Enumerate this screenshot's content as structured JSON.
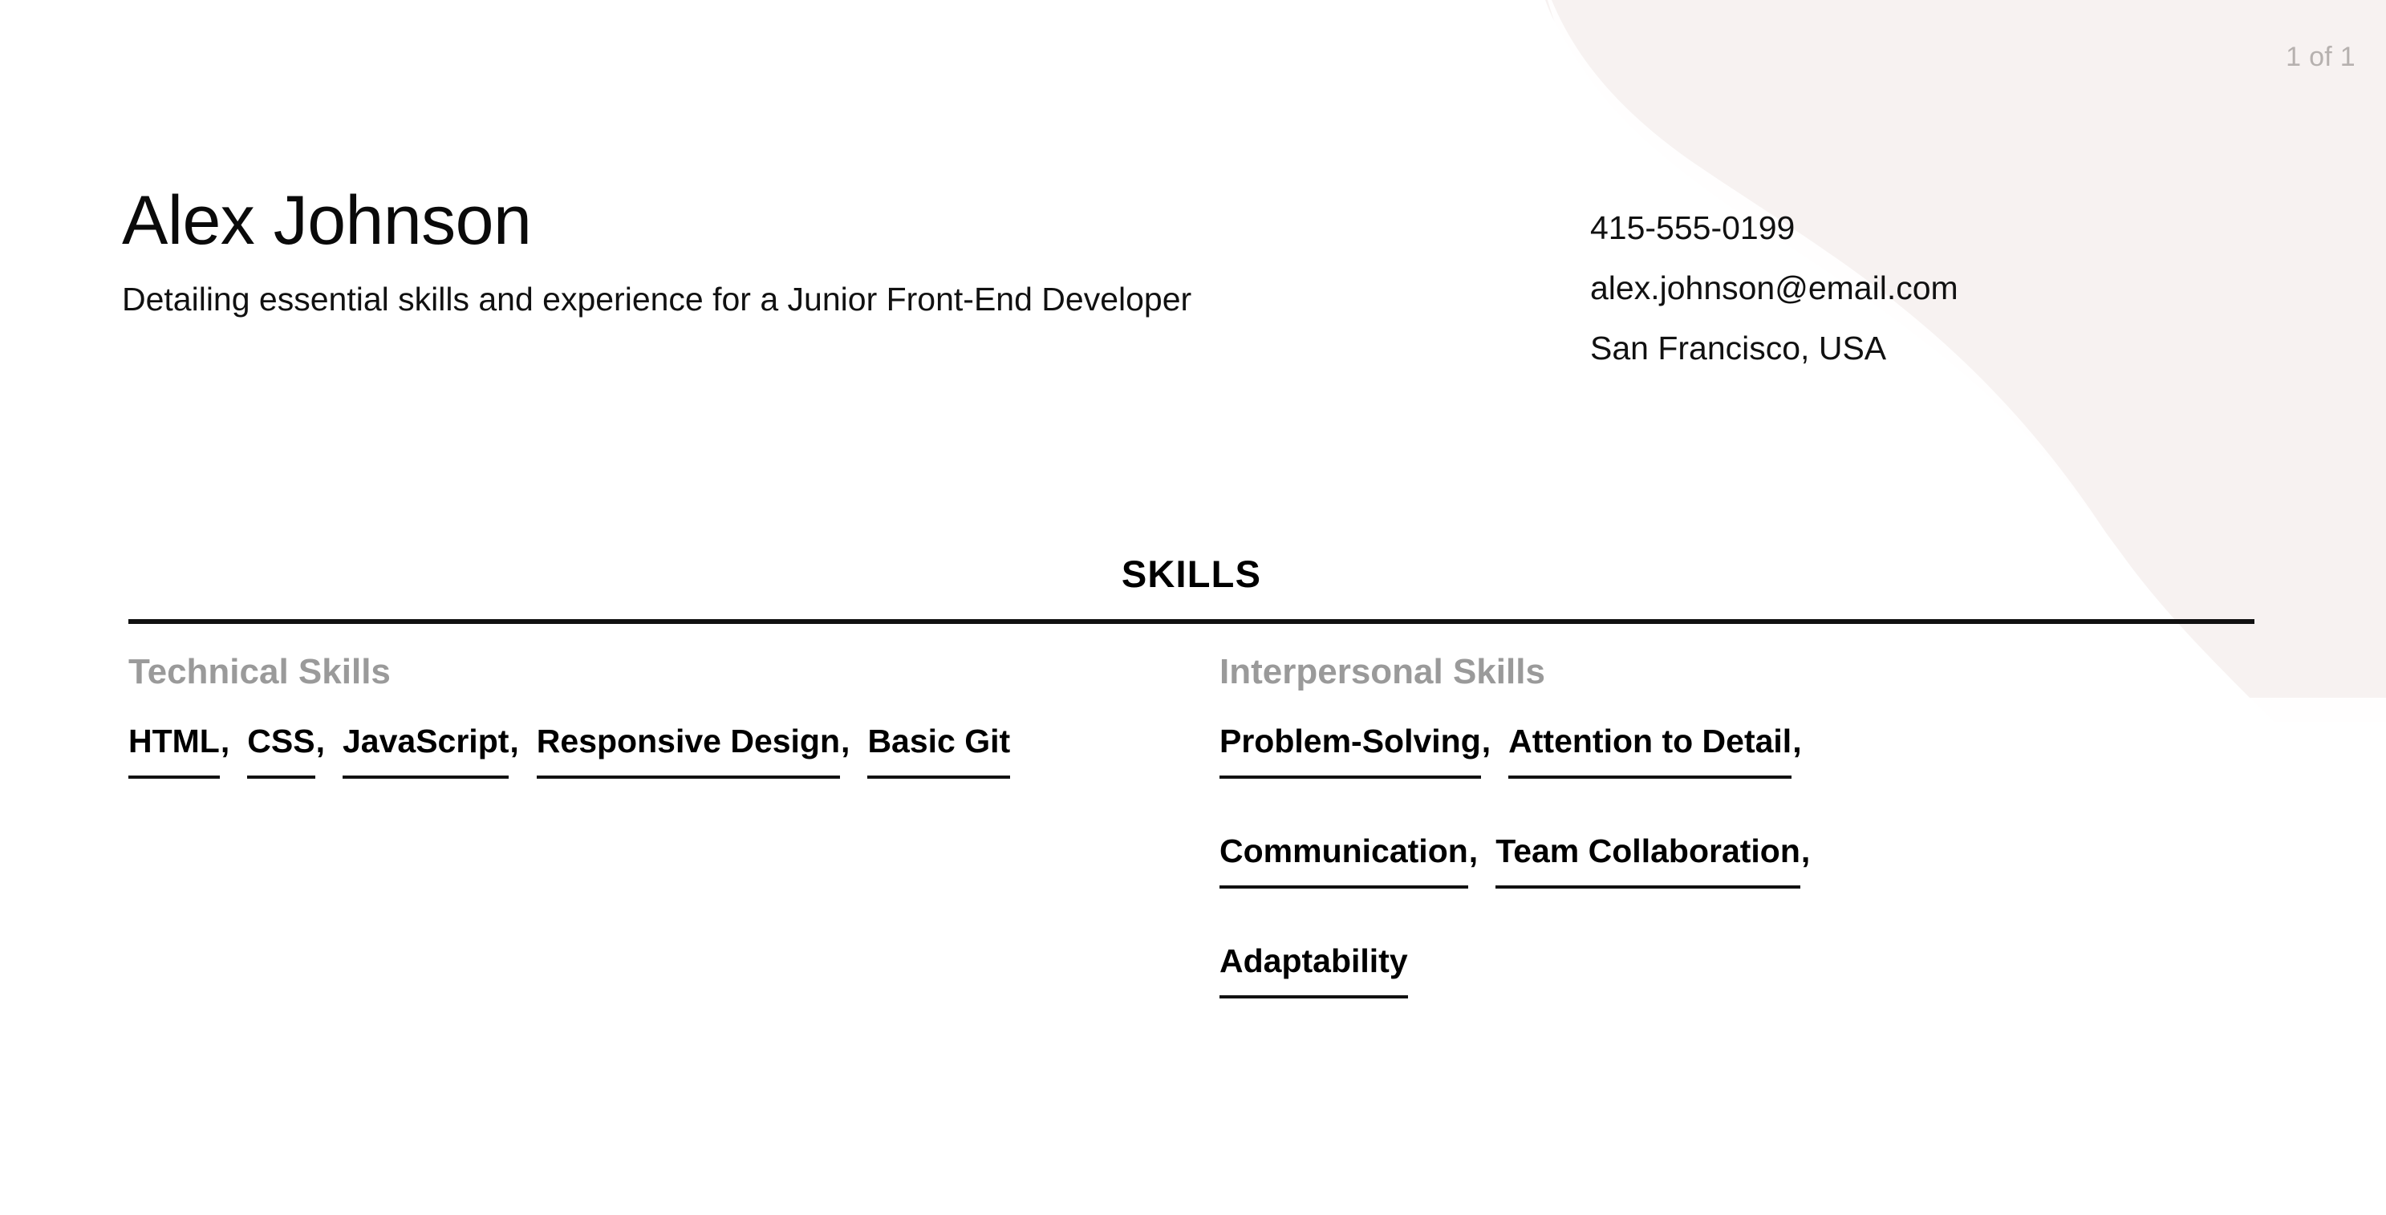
{
  "page_counter": "1 of 1",
  "header": {
    "full_name": "Alex Johnson",
    "headline": "Detailing essential skills and experience for a Junior Front-End Developer",
    "contact": {
      "phone": "415-555-0199",
      "email": "alex.johnson@email.com",
      "location": "San Francisco, USA"
    }
  },
  "skills_section": {
    "title": "SKILLS",
    "groups": [
      {
        "label": "Technical Skills",
        "items": [
          {
            "name": "HTML",
            "separator": ","
          },
          {
            "name": "CSS",
            "separator": ","
          },
          {
            "name": "JavaScript",
            "separator": ","
          },
          {
            "name": "Responsive Design",
            "separator": ","
          },
          {
            "name": "Basic Git",
            "separator": ""
          }
        ]
      },
      {
        "label": "Interpersonal Skills",
        "items": [
          {
            "name": "Problem-Solving",
            "separator": ","
          },
          {
            "name": "Attention to Detail",
            "separator": ","
          },
          {
            "name": "Communication",
            "separator": ","
          },
          {
            "name": "Team Collaboration",
            "separator": ","
          },
          {
            "name": "Adaptability",
            "separator": ""
          }
        ]
      }
    ]
  },
  "theme": {
    "page_background": "#ffffff",
    "text_primary": "#111111",
    "group_label_gray": "#9a9a9a",
    "page_counter_gray": "#b6b1af",
    "rule_color": "#111111",
    "decor_blob_color": "#f7f2f1",
    "decor_swoosh_color": "#ffffff"
  }
}
